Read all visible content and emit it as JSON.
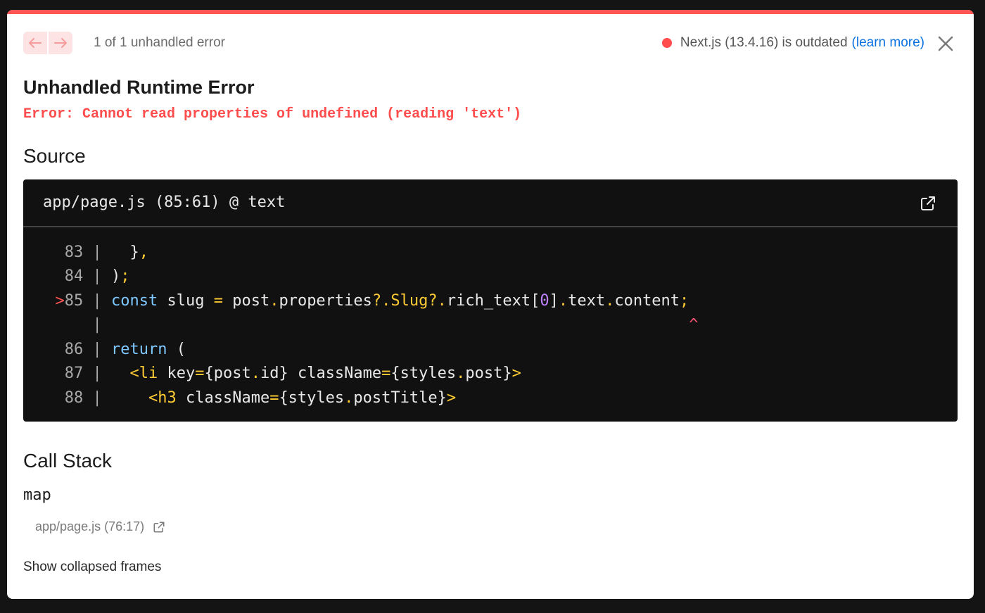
{
  "header": {
    "error_count": "1 of 1 unhandled error",
    "version_text": "Next.js (13.4.16) is outdated",
    "learn_more": "(learn more)",
    "status_color": "#ff4d4d"
  },
  "error": {
    "title": "Unhandled Runtime Error",
    "message": "Error: Cannot read properties of undefined (reading 'text')"
  },
  "source": {
    "heading": "Source",
    "location": "app/page.js (85:61) @ text",
    "lines": [
      {
        "no": "83",
        "marker": "",
        "code": "  },"
      },
      {
        "no": "84",
        "marker": "",
        "code": ");"
      },
      {
        "no": "85",
        "marker": ">",
        "code": "const slug = post.properties?.Slug?.rich_text[0].text.content;"
      },
      {
        "no": "",
        "marker": "",
        "code": "                                                              ^"
      },
      {
        "no": "86",
        "marker": "",
        "code": "return ("
      },
      {
        "no": "87",
        "marker": "",
        "code": "  <li key={post.id} className={styles.post}>"
      },
      {
        "no": "88",
        "marker": "",
        "code": "    <h3 className={styles.postTitle}>"
      }
    ]
  },
  "call_stack": {
    "heading": "Call Stack",
    "frames": [
      {
        "fn": "map",
        "file": "app/page.js (76:17)"
      }
    ],
    "show_collapsed": "Show collapsed frames"
  }
}
